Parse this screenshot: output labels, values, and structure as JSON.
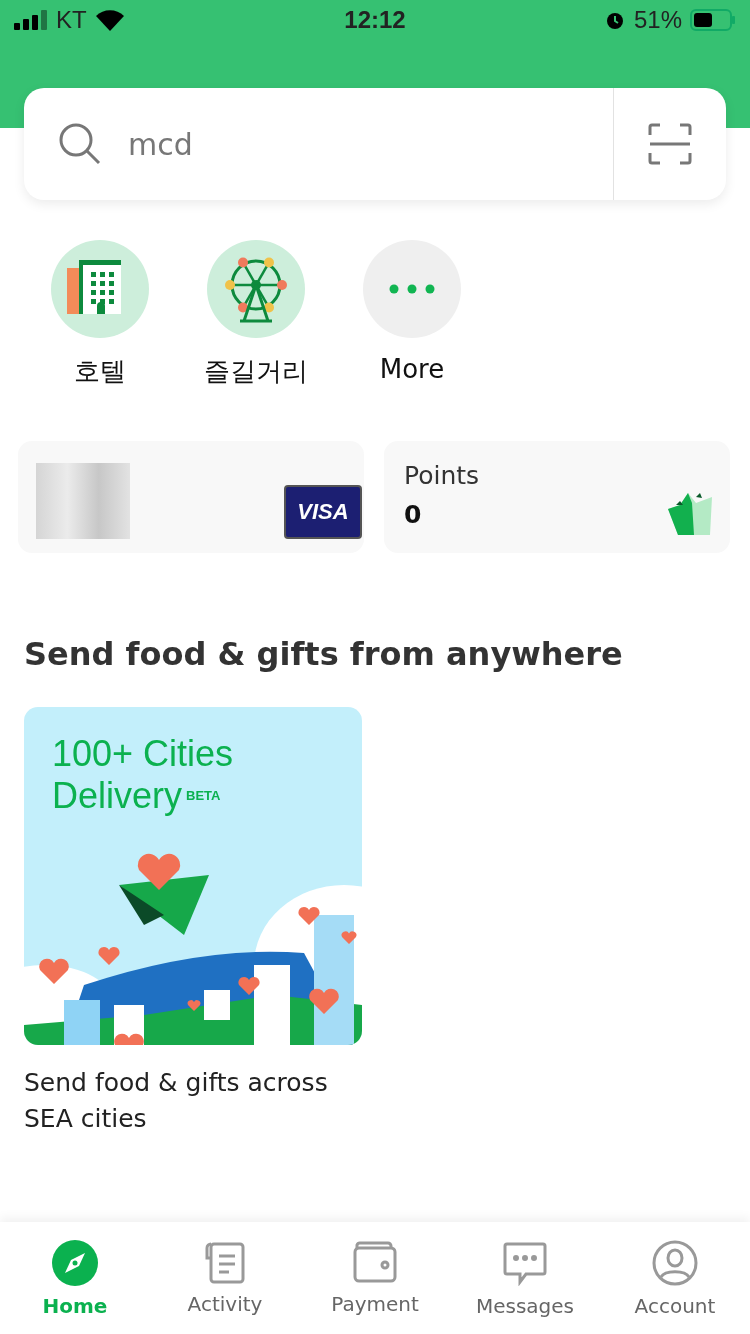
{
  "status_bar": {
    "carrier": "KT",
    "time": "12:12",
    "battery": "51%"
  },
  "search": {
    "value": "mcd"
  },
  "services": [
    {
      "kind": "hotel",
      "label": "호텔"
    },
    {
      "kind": "fun",
      "label": "즐길거리"
    },
    {
      "kind": "more",
      "label": "More"
    }
  ],
  "payment_card": {
    "brand": "VISA"
  },
  "points": {
    "label": "Points",
    "value": "0"
  },
  "section": {
    "title": "Send food & gifts from anywhere"
  },
  "promos": [
    {
      "headline": "100+ Cities Delivery",
      "badge": "BETA",
      "caption": "Send food & gifts across SEA cities"
    }
  ],
  "bottom_nav": [
    {
      "kind": "home",
      "label": "Home",
      "selected": true
    },
    {
      "kind": "activity",
      "label": "Activity",
      "selected": false
    },
    {
      "kind": "payment",
      "label": "Payment",
      "selected": false
    },
    {
      "kind": "messages",
      "label": "Messages",
      "selected": false
    },
    {
      "kind": "account",
      "label": "Account",
      "selected": false
    }
  ]
}
